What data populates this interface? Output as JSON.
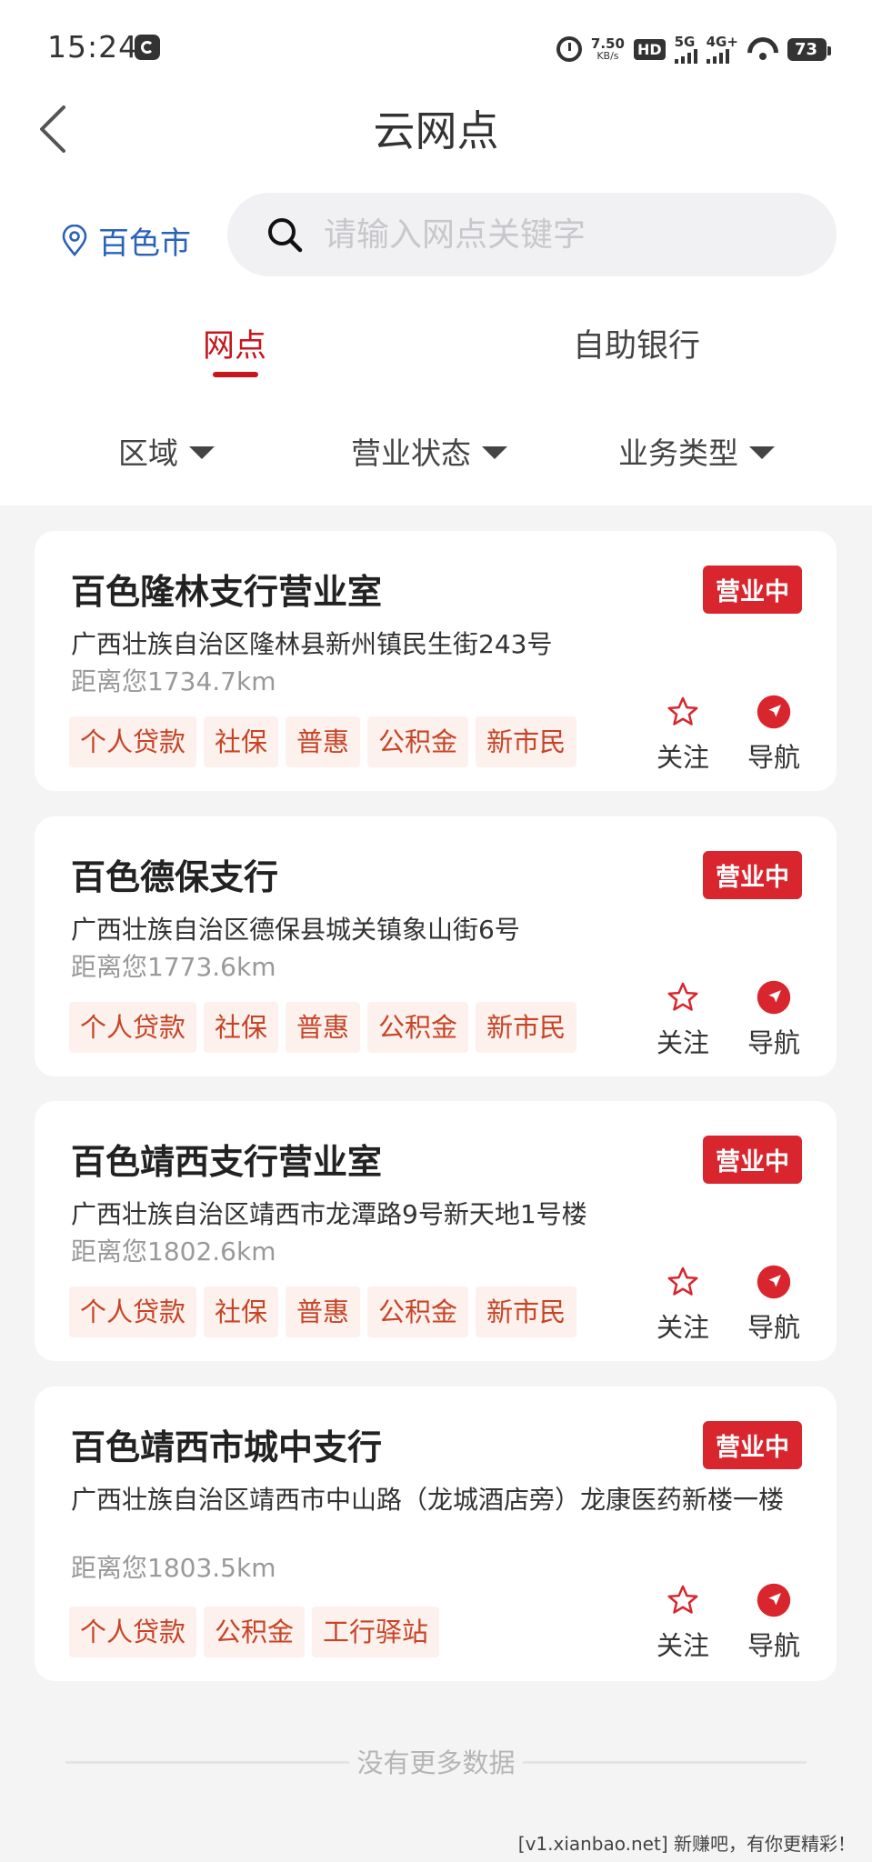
{
  "status_bar": {
    "time": "15:24",
    "speed_value": "7.50",
    "speed_unit": "KB/s",
    "hd_label": "HD",
    "net1": "5G",
    "net2": "4G+",
    "battery": "73"
  },
  "header": {
    "title": "云网点"
  },
  "location": {
    "city": "百色市"
  },
  "search": {
    "placeholder": "请输入网点关键字"
  },
  "tabs": [
    {
      "label": "网点",
      "active": true
    },
    {
      "label": "自助银行",
      "active": false
    }
  ],
  "filters": [
    {
      "label": "区域"
    },
    {
      "label": "营业状态"
    },
    {
      "label": "业务类型"
    }
  ],
  "actions": {
    "follow_label": "关注",
    "navigate_label": "导航"
  },
  "branches": [
    {
      "name": "百色隆林支行营业室",
      "status": "营业中",
      "address": "广西壮族自治区隆林县新州镇民生街243号",
      "distance": "距离您1734.7km",
      "tags": [
        "个人贷款",
        "社保",
        "普惠",
        "公积金",
        "新市民"
      ]
    },
    {
      "name": "百色德保支行",
      "status": "营业中",
      "address": "广西壮族自治区德保县城关镇象山街6号",
      "distance": "距离您1773.6km",
      "tags": [
        "个人贷款",
        "社保",
        "普惠",
        "公积金",
        "新市民"
      ]
    },
    {
      "name": "百色靖西支行营业室",
      "status": "营业中",
      "address": "广西壮族自治区靖西市龙潭路9号新天地1号楼",
      "distance": "距离您1802.6km",
      "tags": [
        "个人贷款",
        "社保",
        "普惠",
        "公积金",
        "新市民"
      ]
    },
    {
      "name": "百色靖西市城中支行",
      "status": "营业中",
      "address": "广西壮族自治区靖西市中山路（龙城酒店旁）龙康医药新楼一楼",
      "distance": "距离您1803.5km",
      "tags": [
        "个人贷款",
        "公积金",
        "工行驿站"
      ]
    }
  ],
  "footer": {
    "no_more": "没有更多数据"
  },
  "watermark": "[v1.xianbao.net] 新赚吧，有你更精彩！",
  "colors": {
    "accent": "#c8161d",
    "badge": "#d9262e",
    "link": "#2a62b8",
    "tag_text": "#c64526",
    "tag_bg": "#fdf1ee"
  }
}
